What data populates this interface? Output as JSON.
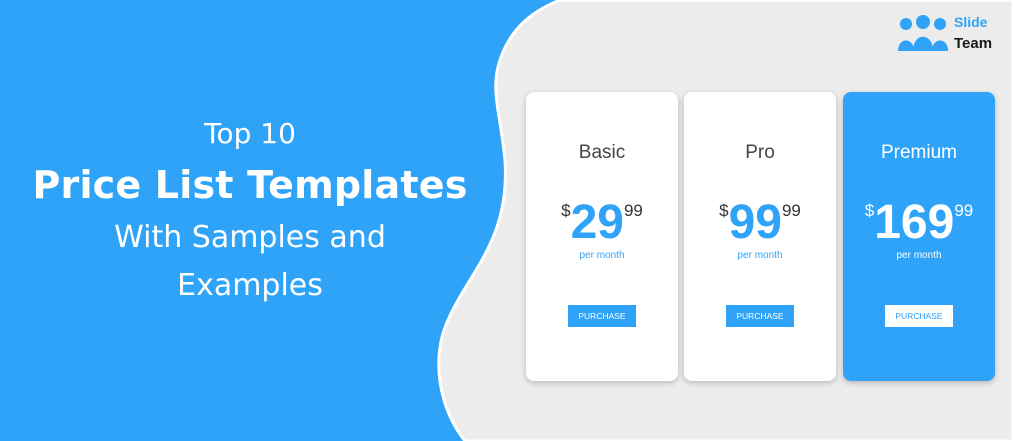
{
  "colors": {
    "accent": "#2ea3f8",
    "background_right": "#ececec",
    "card": "#ffffff",
    "text_dark": "#444444"
  },
  "hero": {
    "line1": "Top 10",
    "line2": "Price List Templates",
    "line3": "With Samples and",
    "line4": "Examples"
  },
  "logo": {
    "word1": "Slide",
    "word2": "Team",
    "icon": "people-group-icon"
  },
  "plans": [
    {
      "name": "Basic",
      "currency": "$",
      "amount": "29",
      "cents": "99",
      "period": "per month",
      "button": "PURCHASE"
    },
    {
      "name": "Pro",
      "currency": "$",
      "amount": "99",
      "cents": "99",
      "period": "per month",
      "button": "PURCHASE"
    },
    {
      "name": "Premium",
      "currency": "$",
      "amount": "169",
      "cents": "99",
      "period": "per month",
      "button": "PURCHASE"
    }
  ]
}
